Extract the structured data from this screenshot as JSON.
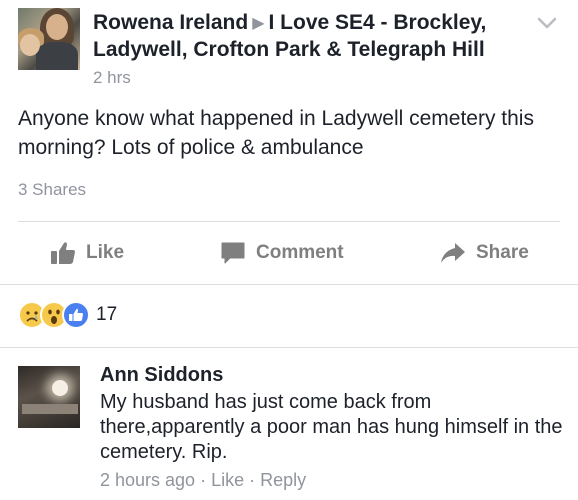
{
  "post": {
    "author": "Rowena Ireland",
    "group": "I Love SE4 - Brockley, Ladywell, Crofton Park & Telegraph Hill",
    "time": "2 hrs",
    "body": "Anyone know what happened in Ladywell cemetery this morning? Lots of police & ambulance",
    "shares": "3 Shares"
  },
  "actions": {
    "like": "Like",
    "comment": "Comment",
    "share": "Share"
  },
  "reactions": {
    "count": "17",
    "types": [
      "sad",
      "wow",
      "like"
    ]
  },
  "comment": {
    "name": "Ann Siddons",
    "text": "My husband has just come back from there,apparently a poor man has hung himself in the cemetery. Rip.",
    "time": "2 hours ago",
    "sep": " · ",
    "like": "Like",
    "reply": "Reply"
  },
  "colors": {
    "text": "#1d2129",
    "muted": "#90949c",
    "action": "#7f7f7f",
    "likeBlue": "#4a7ff0"
  }
}
